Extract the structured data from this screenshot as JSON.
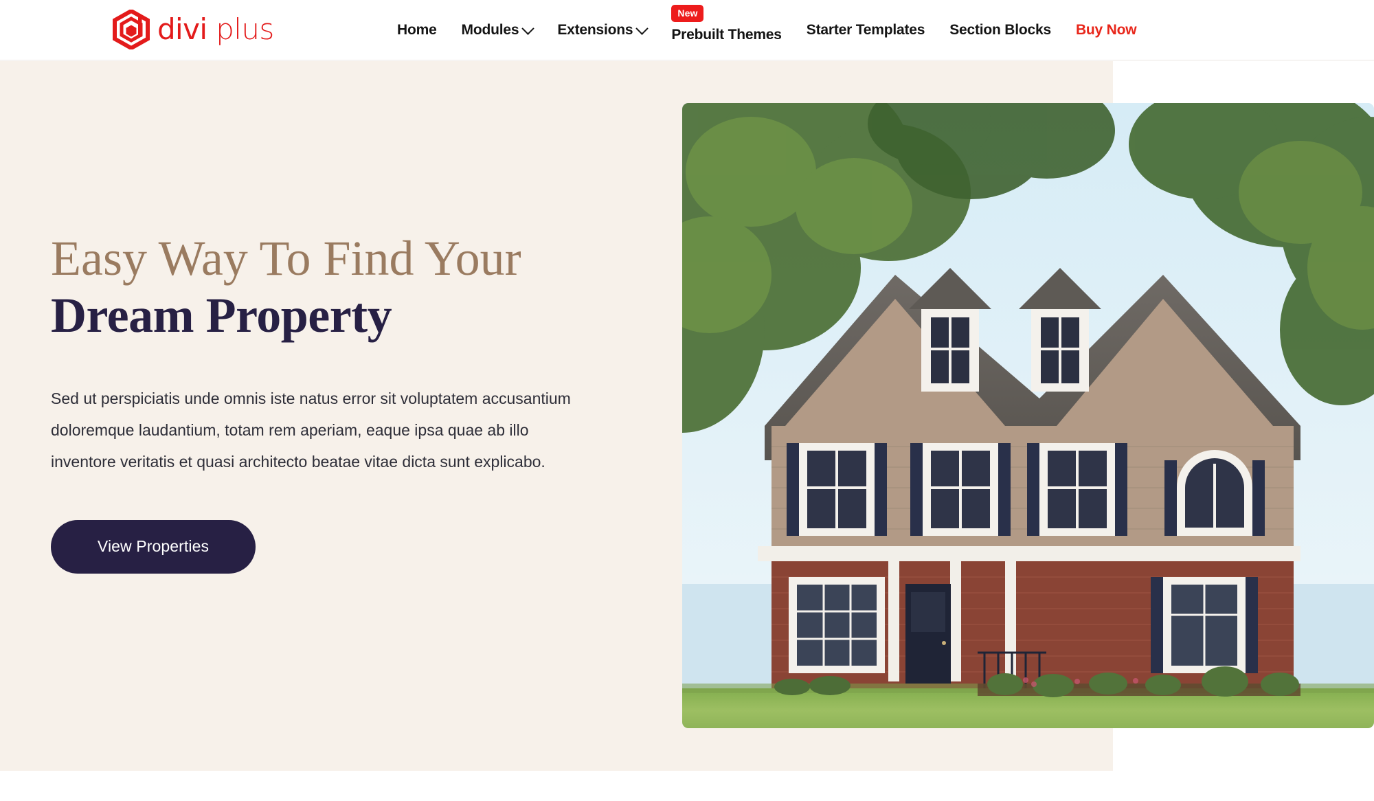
{
  "header": {
    "logo": {
      "icon": "divi-plus-hexagon-logo",
      "text_primary": "divi",
      "text_secondary": "plus",
      "color": "#e31b1b"
    },
    "nav_items": [
      {
        "label": "Home",
        "has_dropdown": false,
        "badge": null,
        "accent": false
      },
      {
        "label": "Modules",
        "has_dropdown": true,
        "badge": null,
        "accent": false
      },
      {
        "label": "Extensions",
        "has_dropdown": true,
        "badge": null,
        "accent": false
      },
      {
        "label": "Prebuilt Themes",
        "has_dropdown": false,
        "badge": "New",
        "accent": false
      },
      {
        "label": "Starter Templates",
        "has_dropdown": false,
        "badge": null,
        "accent": false
      },
      {
        "label": "Section Blocks",
        "has_dropdown": false,
        "badge": null,
        "accent": false
      },
      {
        "label": "Buy Now",
        "has_dropdown": false,
        "badge": null,
        "accent": true
      }
    ]
  },
  "hero": {
    "heading_line1": "Easy Way To Find Your",
    "heading_line2": "Dream Property",
    "paragraph": "Sed ut perspiciatis unde omnis iste natus error sit voluptatem accusantium doloremque laudantium, totam rem aperiam, eaque ipsa quae ab illo inventore veritatis et quasi architecto beatae vitae dicta sunt explicabo.",
    "cta_label": "View Properties",
    "image_alt": "two-story suburban house with brick facade, tan siding, navy shutters and green lawn",
    "colors": {
      "background": "#f7f1ea",
      "heading_accent": "#9a7b60",
      "heading_main": "#272044",
      "button_bg": "#272044",
      "button_text": "#ffffff",
      "nav_accent": "#e8261a",
      "badge_bg": "#ed1c1c"
    }
  }
}
